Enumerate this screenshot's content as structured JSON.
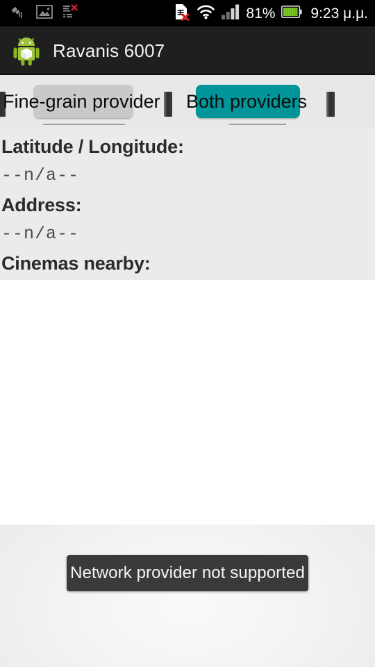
{
  "status_bar": {
    "left_icons": [
      {
        "name": "gps-satellite-icon",
        "label": "GPS"
      },
      {
        "name": "image-gallery-icon",
        "label": "Screenshot saved"
      },
      {
        "name": "sync-error-icon",
        "label": "Sync error"
      }
    ],
    "right_icons": [
      {
        "name": "sim-card-error-icon",
        "label": "No SIM"
      },
      {
        "name": "wifi-icon",
        "label": "Wi-Fi"
      },
      {
        "name": "cellular-signal-icon",
        "label": "Signal"
      }
    ],
    "battery_percent": "81%",
    "battery_icon": "battery-icon",
    "clock": "9:23 μ.μ.",
    "background_color": "#000000"
  },
  "action_bar": {
    "app_icon": "android-robot-icon",
    "title": "Ravanis 6007",
    "background_color": "#1f1f1f",
    "title_color": "#f2f2f2"
  },
  "tab_strip": {
    "background_color": "#e8e8e8",
    "buttons": [
      {
        "id": "fine-grain-provider",
        "label": "Fine-grain provider",
        "selected": false,
        "pill_color": "#c9c9c9"
      },
      {
        "id": "both-providers",
        "label": "Both providers",
        "selected": true,
        "pill_color": "#009699"
      }
    ],
    "dividers": 3
  },
  "info_panel": {
    "background_color": "#ebebeb",
    "rows": [
      {
        "label": "Latitude / Longitude:",
        "value": "--n/a--"
      },
      {
        "label": "Address:",
        "value": "--n/a--"
      }
    ],
    "section_heading": "Cinemas nearby:"
  },
  "results_list": {
    "items": [],
    "background_color": "#ffffff"
  },
  "toast": {
    "message": "Network provider not supported",
    "background_color": "#3a3a3a",
    "text_color": "#f5f5f5"
  }
}
